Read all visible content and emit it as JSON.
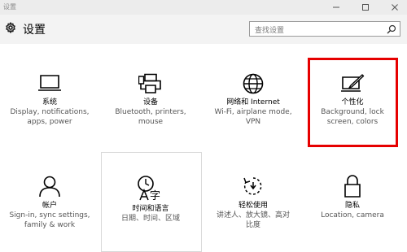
{
  "window": {
    "title": "设置"
  },
  "header": {
    "title": "设置",
    "search_placeholder": "查找设置"
  },
  "tiles": [
    {
      "name": "系统",
      "desc": [
        "Display, notifications,",
        "apps, power"
      ],
      "icon": "laptop-icon"
    },
    {
      "name": "设备",
      "desc": [
        "Bluetooth, printers,",
        "mouse"
      ],
      "icon": "printer-icon"
    },
    {
      "name": "网络和 Internet",
      "desc": [
        "Wi-Fi, airplane mode,",
        "VPN"
      ],
      "icon": "globe-icon"
    },
    {
      "name": "个性化",
      "desc": [
        "Background, lock",
        "screen, colors"
      ],
      "icon": "paint-icon"
    },
    {
      "name": "帐户",
      "desc": [
        "Sign-in, sync settings,",
        "family & work"
      ],
      "icon": "person-icon"
    },
    {
      "name": "时间和语言",
      "desc": [
        "日期、时间、区域"
      ],
      "icon": "time-language-icon"
    },
    {
      "name": "轻松使用",
      "desc": [
        "讲述人、放大镜、高对",
        "比度"
      ],
      "icon": "ease-of-access-icon"
    },
    {
      "name": "隐私",
      "desc": [
        "Location, camera"
      ],
      "icon": "lock-icon"
    }
  ],
  "colors": {
    "highlight": "#e60000",
    "header_bg": "#f3f3f3",
    "titlebar_bg": "#ececec"
  }
}
